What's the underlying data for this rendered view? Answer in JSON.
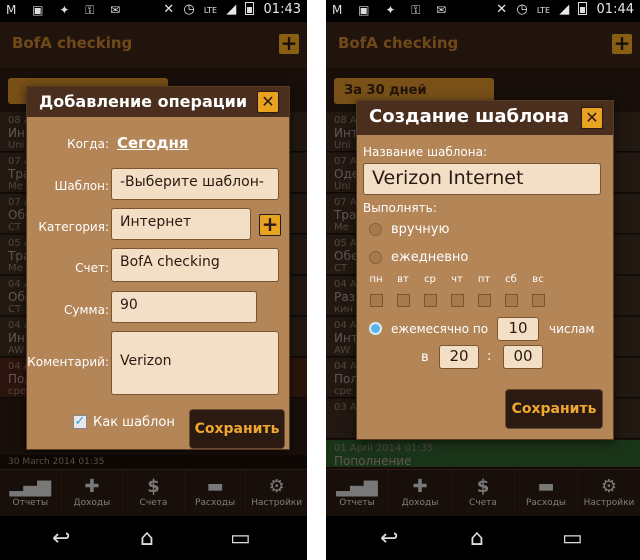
{
  "status": {
    "left_time": "01:43",
    "right_time": "01:44",
    "network": "LTE"
  },
  "app": {
    "title": "BofA checking",
    "period": "За 30 дней",
    "list_peek_left": [
      "08 A",
      "Инт",
      "Uni",
      "07 A",
      "Тра",
      "Me",
      "07 A",
      "Обе",
      "CT",
      "05 A",
      "Тра",
      "Me",
      "04 A",
      "Обе",
      "CT",
      "04 A",
      "Инт",
      "AW",
      "04 A",
      "Пол",
      "сре"
    ],
    "list_peek_right": [
      "08 A",
      "Инт",
      "Uni",
      "07 A",
      "Оде",
      "Uni",
      "07 A",
      "Тра",
      "Me",
      "05 A",
      "Обе",
      "CT",
      "04 A",
      "Раз",
      "кин",
      "04 A",
      "Инт",
      "AW",
      "04 A",
      "Пол",
      "сре",
      "03 Ap"
    ],
    "bottom_date_left": "30 March 2014 01:35",
    "bottom_date_right": "01 April 2014 01:35",
    "bottom_row_right": "Пополнение"
  },
  "tabs": [
    {
      "label": "Отчеты",
      "icon": "bar-chart-icon"
    },
    {
      "label": "Доходы",
      "icon": "plus-icon"
    },
    {
      "label": "Счета",
      "icon": "dollar-icon"
    },
    {
      "label": "Расходы",
      "icon": "minus-icon"
    },
    {
      "label": "Настройки",
      "icon": "gear-icon"
    }
  ],
  "add_dialog": {
    "title": "Добавление операции",
    "when_label": "Когда:",
    "when_value": "Сегодня",
    "template_label": "Шаблон:",
    "template_value": "-Выберите шаблон-",
    "category_label": "Категория:",
    "category_value": "Интернет",
    "account_label": "Счет:",
    "account_value": "BofA checking",
    "amount_label": "Сумма:",
    "amount_value": "90",
    "comment_label": "Коментарий:",
    "comment_value": "Verizon",
    "as_template_label": "Как шаблон",
    "as_template_checked": true,
    "save_label": "Сохранить"
  },
  "template_dialog": {
    "title": "Создание шаблона",
    "name_label": "Название шаблона:",
    "name_value": "Verizon Internet",
    "execute_label": "Выполнять:",
    "manual_label": "вручную",
    "daily_label": "ежедневно",
    "days": [
      "пн",
      "вт",
      "ср",
      "чт",
      "пт",
      "сб",
      "вс"
    ],
    "monthly_prefix": "ежемесячно по",
    "monthly_day": "10",
    "monthly_suffix": "числам",
    "at_label": "в",
    "hour": "20",
    "time_sep": ":",
    "minute": "00",
    "selected_mode": "monthly",
    "save_label": "Сохранить"
  },
  "colors": {
    "accent": "#e8a320",
    "dialog_bg": "#b38557",
    "save_text": "#f0a830"
  }
}
